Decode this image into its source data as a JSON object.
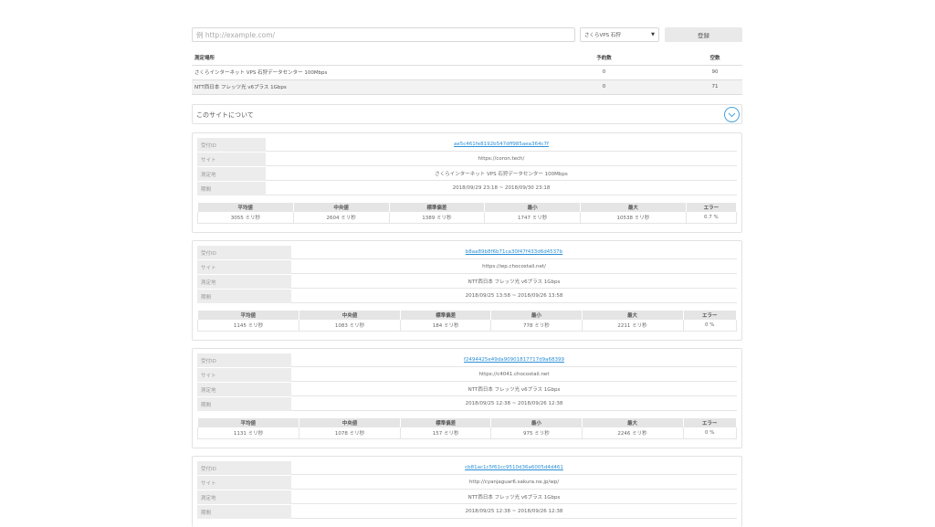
{
  "search": {
    "placeholder": "例 http://example.com/"
  },
  "location_select": {
    "selected": "さくらVPS 石狩",
    "caret": "▼"
  },
  "register_button": {
    "label": "登録"
  },
  "location_table": {
    "headers": {
      "location": "測定場所",
      "reserved": "予約数",
      "vacant": "空数"
    },
    "rows": [
      {
        "name": "さくらインターネット VPS 石狩データセンター 100Mbps",
        "reserved": "0",
        "vacant": "90"
      },
      {
        "name": "NTT西日本 フレッツ光 v6プラス 1Gbps",
        "reserved": "0",
        "vacant": "71"
      }
    ]
  },
  "about": {
    "label": "このサイトについて",
    "icon": "chevron-down-icon"
  },
  "labels": {
    "id": "受付ID",
    "site": "サイト",
    "place": "測定地",
    "period": "期間"
  },
  "stat_headers": [
    "平均値",
    "中央値",
    "標準偏差",
    "最小",
    "最大",
    "エラー"
  ],
  "results": [
    {
      "id": "ae5c461fe8192b547dff985aea364c7f",
      "site": "https://coron.tech/",
      "place": "さくらインターネット VPS 石狩データセンター 100Mbps",
      "period": "2018/09/29 23:18 ~ 2018/09/30 23:18",
      "stats": [
        "3055 ミリ秒",
        "2604 ミリ秒",
        "1389 ミリ秒",
        "1747 ミリ秒",
        "10538 ミリ秒",
        "0.7 %"
      ]
    },
    {
      "id": "b8aa89b8f6b71ca30f47f433d6d4537b",
      "site": "https://wp.chocostail.net/",
      "place": "NTT西日本 フレッツ光 v6プラス 1Gbps",
      "period": "2018/09/25 13:58 ~ 2018/09/26 13:58",
      "stats": [
        "1145 ミリ秒",
        "1083 ミリ秒",
        "184 ミリ秒",
        "778 ミリ秒",
        "2211 ミリ秒",
        "0 %"
      ]
    },
    {
      "id": "f2494425e49da90901817717d9a68399",
      "site": "https://c4041.chocostail.net",
      "place": "NTT西日本 フレッツ光 v6プラス 1Gbps",
      "period": "2018/09/25 12:38 ~ 2018/09/26 12:38",
      "stats": [
        "1131 ミリ秒",
        "1078 ミリ秒",
        "157 ミリ秒",
        "975 ミリ秒",
        "2246 ミリ秒",
        "0 %"
      ]
    },
    {
      "id": "cb81ac1c5f61cc9510d36a6005d4d461",
      "site": "http://cyanjaguar6.sakura.ne.jp/wp/",
      "place": "NTT西日本 フレッツ光 v6プラス 1Gbps",
      "period": "2018/09/25 12:38 ~ 2018/09/26 12:38"
    }
  ]
}
